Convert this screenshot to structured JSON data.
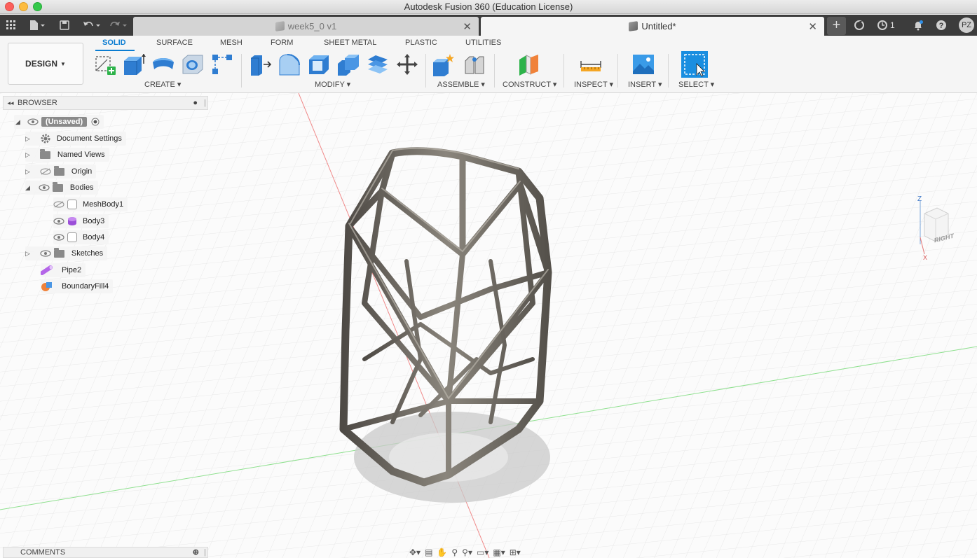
{
  "window": {
    "title": "Autodesk Fusion 360 (Education License)"
  },
  "tabs": [
    {
      "label": "week5_0 v1",
      "active": false
    },
    {
      "label": "Untitled*",
      "active": true
    }
  ],
  "header_right": {
    "job_count": "1",
    "user_initials": "PZ"
  },
  "toolbar": {
    "workspace_label": "DESIGN",
    "workspace_tabs": [
      "SOLID",
      "SURFACE",
      "MESH",
      "FORM",
      "SHEET METAL",
      "PLASTIC",
      "UTILITIES"
    ],
    "groups": [
      "CREATE",
      "MODIFY",
      "ASSEMBLE",
      "CONSTRUCT",
      "INSPECT",
      "INSERT",
      "SELECT"
    ]
  },
  "browser": {
    "title": "BROWSER",
    "root": "(Unsaved)",
    "items": [
      "Document Settings",
      "Named Views",
      "Origin",
      "Bodies",
      "MeshBody1",
      "Body3",
      "Body4",
      "Sketches",
      "Pipe2",
      "BoundaryFill4"
    ]
  },
  "comments": {
    "title": "COMMENTS"
  },
  "viewcube": {
    "face_label": "RIGHT",
    "axis_z": "Z",
    "axis_x": "X"
  },
  "colors": {
    "accent": "#0a7cd1",
    "model": "#6e6a63",
    "select_blue": "#1a8ee0"
  },
  "icons": [
    "apps-grid-icon",
    "file-icon",
    "save-icon",
    "undo-icon",
    "redo-icon",
    "plus-icon",
    "refresh-icon",
    "clock-icon",
    "bell-icon",
    "help-icon"
  ]
}
